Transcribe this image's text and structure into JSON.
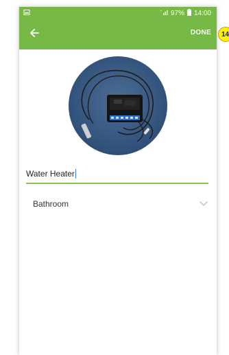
{
  "status_bar": {
    "battery": "97%",
    "time": "14:00"
  },
  "app_bar": {
    "done_label": "DONE"
  },
  "form": {
    "name_value": "Water Heater",
    "room_value": "Bathroom"
  },
  "step_badge": "14",
  "colors": {
    "accent": "#76b947",
    "underline": "#8bc34a",
    "badge": "#fff200"
  },
  "icons": {
    "back": "back-arrow-icon",
    "dropdown": "chevron-down-icon",
    "signal": "signal-icon",
    "battery": "battery-icon"
  }
}
